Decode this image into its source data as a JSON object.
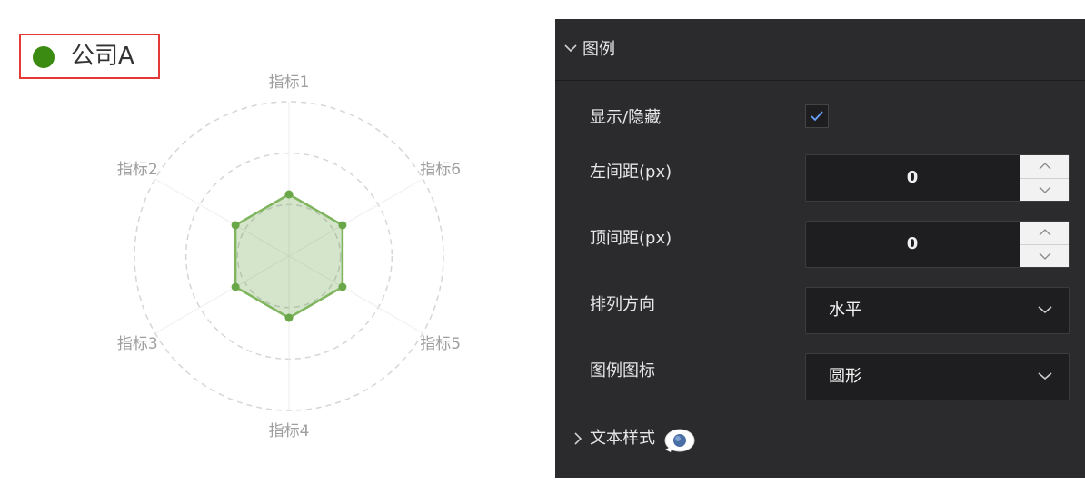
{
  "chart": {
    "legend_label": "公司A",
    "series_color": "#3b8a12",
    "highlight_color": "#e53935"
  },
  "chart_data": {
    "type": "radar",
    "indicators": [
      "指标1",
      "指标6",
      "指标5",
      "指标4",
      "指标3",
      "指标2"
    ],
    "series": [
      {
        "name": "公司A",
        "values": [
          4,
          4,
          4,
          4,
          4,
          4
        ]
      }
    ],
    "max": 10,
    "rings": 3
  },
  "panel": {
    "section_title": "图例",
    "show_hide_label": "显示/隐藏",
    "show_checked": true,
    "left_margin_label": "左间距(px)",
    "left_margin_value": "0",
    "top_margin_label": "顶间距(px)",
    "top_margin_value": "0",
    "direction_label": "排列方向",
    "direction_value": "水平",
    "legend_icon_label": "图例图标",
    "legend_icon_value": "圆形",
    "text_style_label": "文本样式"
  }
}
